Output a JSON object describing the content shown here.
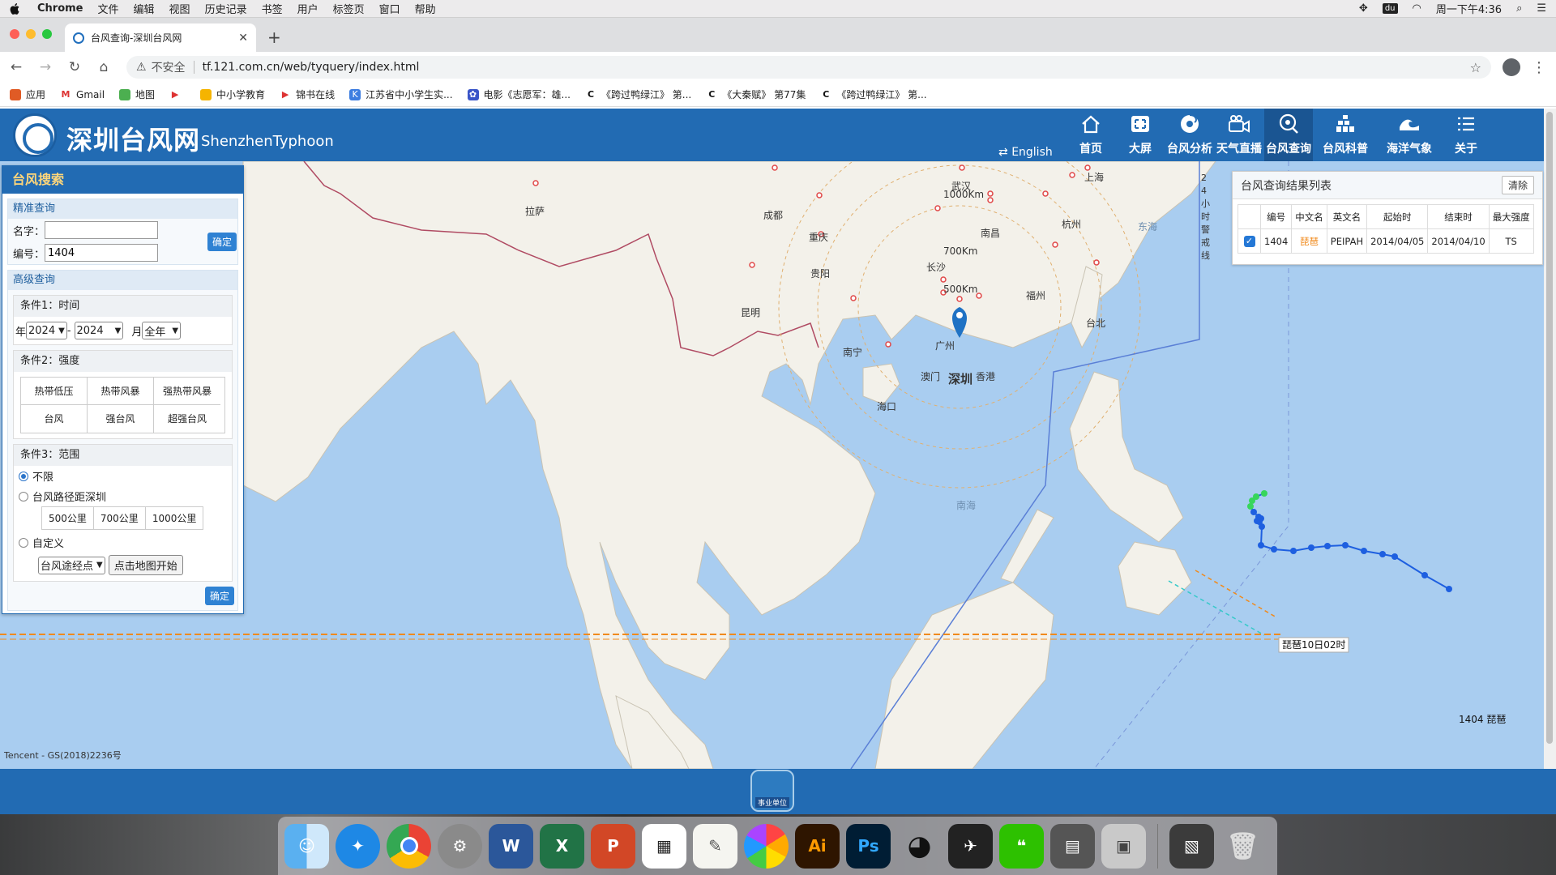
{
  "menubar": {
    "app": "Chrome",
    "items": [
      "文件",
      "编辑",
      "视图",
      "历史记录",
      "书签",
      "用户",
      "标签页",
      "窗口",
      "帮助"
    ],
    "clock": "周一下午4:36"
  },
  "browser": {
    "tab_title": "台风查询-深圳台风网",
    "security": "不安全",
    "url": "tf.121.com.cn/web/tyquery/index.html",
    "bookmarks": [
      "应用",
      "Gmail",
      "地图",
      "",
      "中小学教育",
      "锦书在线",
      "江苏省中小学生实...",
      "电影《志愿军：雄...",
      "《跨过鸭绿江》 第...",
      "《大秦赋》 第77集",
      "《跨过鸭绿江》 第..."
    ]
  },
  "site": {
    "title": "深圳台风网",
    "subtitle": "ShenzhenTyphoon",
    "english": "English",
    "nav": [
      "首页",
      "大屏",
      "台风分析",
      "天气直播",
      "台风查询",
      "台风科普",
      "海洋气象",
      "关于"
    ]
  },
  "search": {
    "title": "台风搜索",
    "exact_header": "精准查询",
    "name_label": "名字：",
    "name_value": "",
    "number_label": "编号：",
    "number_value": "1404",
    "confirm": "确定",
    "advanced_header": "高级查询",
    "cond1_title": "条件1：时间",
    "year_label": "年",
    "year_from": "2024",
    "dash": "-",
    "year_to": "2024",
    "month_label": "月",
    "month_value": "全年",
    "cond2_title": "条件2：强度",
    "strengths": [
      "热带低压",
      "热带风暴",
      "强热带风暴",
      "台风",
      "强台风",
      "超强台风"
    ],
    "cond3_title": "条件3：范围",
    "opt_unlimited": "不限",
    "opt_distance": "台风路径距深圳",
    "distances": [
      "500公里",
      "700公里",
      "1000公里"
    ],
    "opt_custom": "自定义",
    "custom_select": "台风途经点",
    "custom_button": "点击地图开始",
    "bottom_confirm": "确定"
  },
  "results": {
    "title": "台风查询结果列表",
    "clear": "清除",
    "columns": [
      "编号",
      "中文名",
      "英文名",
      "起始时",
      "结束时",
      "最大强度"
    ],
    "rows": [
      {
        "id": "1404",
        "cn": "琵琶",
        "en": "PEIPAH",
        "start": "2014/04/05",
        "end": "2014/04/10",
        "max": "TS"
      }
    ]
  },
  "map": {
    "cities": [
      "拉萨",
      "成都",
      "重庆",
      "贵阳",
      "昆明",
      "南宁",
      "海口",
      "澳门",
      "深圳",
      "香港",
      "广州",
      "长沙",
      "武汉",
      "南昌",
      "上海",
      "杭州",
      "福州",
      "台北"
    ],
    "seas": [
      "东海",
      "南海"
    ],
    "rings": [
      "1000Km",
      "700Km",
      "500Km"
    ],
    "warning_line": "24小时警戒线",
    "typhoon_label": "琵琶10日02时",
    "track_label": "1404 琵琶",
    "copyright": "Tencent - GS(2018)2236号"
  },
  "footer": {
    "emblem": "事业单位"
  },
  "colors": {
    "brand": "#226bb3",
    "ocean": "#a9cdf0",
    "land": "#f3f1ea",
    "track": "#1e5fe0",
    "accent": "#f08a1c"
  }
}
